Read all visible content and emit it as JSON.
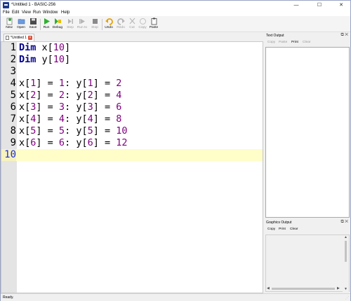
{
  "window": {
    "title": "*Untitled 1 - BASIC-256",
    "minimize_glyph": "—",
    "maximize_glyph": "☐",
    "close_glyph": "✕"
  },
  "menu": [
    "File",
    "Edit",
    "View",
    "Run",
    "Window",
    "Help"
  ],
  "toolbar": {
    "buttons": [
      {
        "label": "New",
        "icon": "new-file-icon",
        "enabled": true
      },
      {
        "label": "Open",
        "icon": "open-folder-icon",
        "enabled": true
      },
      {
        "label": "Save",
        "icon": "save-disk-icon",
        "enabled": true
      },
      {
        "label": "Run",
        "icon": "run-play-icon",
        "enabled": true
      },
      {
        "label": "Debug",
        "icon": "debug-icon",
        "enabled": true
      },
      {
        "label": "Step",
        "icon": "step-icon",
        "enabled": false
      },
      {
        "label": "Run to",
        "icon": "run-to-icon",
        "enabled": false
      },
      {
        "label": "Stop",
        "icon": "stop-icon",
        "enabled": false
      },
      {
        "label": "Undo",
        "icon": "undo-icon",
        "enabled": true
      },
      {
        "label": "Redo",
        "icon": "redo-icon",
        "enabled": false
      },
      {
        "label": "Cut",
        "icon": "cut-icon",
        "enabled": false
      },
      {
        "label": "Copy",
        "icon": "copy-icon",
        "enabled": false
      },
      {
        "label": "Paste",
        "icon": "paste-icon",
        "enabled": true
      }
    ]
  },
  "editor": {
    "tab_label": "*Untitled 1",
    "close_glyph": "×",
    "current_line": 10,
    "lines": [
      {
        "num": "1",
        "kw": "Dim",
        "rest": " x[",
        "n1": "10",
        "tail": "]"
      },
      {
        "num": "2",
        "kw": "Dim",
        "rest": " y[",
        "n1": "10",
        "tail": "]"
      },
      {
        "num": "3",
        "kw": "",
        "rest": "",
        "n1": "",
        "tail": ""
      },
      {
        "num": "4",
        "a": "x[",
        "i": "1",
        "b": "] = ",
        "v": "1",
        "c": ": y[",
        "j": "1",
        "d": "] = ",
        "w": "2"
      },
      {
        "num": "5",
        "a": "x[",
        "i": "2",
        "b": "] = ",
        "v": "2",
        "c": ": y[",
        "j": "2",
        "d": "] = ",
        "w": "4"
      },
      {
        "num": "6",
        "a": "x[",
        "i": "3",
        "b": "] = ",
        "v": "3",
        "c": ": y[",
        "j": "3",
        "d": "] = ",
        "w": "6"
      },
      {
        "num": "7",
        "a": "x[",
        "i": "4",
        "b": "] = ",
        "v": "4",
        "c": ": y[",
        "j": "4",
        "d": "] = ",
        "w": "8"
      },
      {
        "num": "8",
        "a": "x[",
        "i": "5",
        "b": "] = ",
        "v": "5",
        "c": ": y[",
        "j": "5",
        "d": "] = ",
        "w": "10"
      },
      {
        "num": "9",
        "a": "x[",
        "i": "6",
        "b": "] = ",
        "v": "6",
        "c": ": y[",
        "j": "6",
        "d": "] = ",
        "w": "12"
      },
      {
        "num": "10"
      }
    ],
    "colors": {
      "keyword": "#00008b",
      "number": "#800080",
      "current_line_bg": "#fffdc8",
      "current_line_number": "#1c2fd6"
    }
  },
  "text_output": {
    "title": "Text Output",
    "tools": [
      "Copy",
      "Paste",
      "Print",
      "Clear"
    ],
    "dock_glyphs": [
      "⧉",
      "✕"
    ]
  },
  "graphics_output": {
    "title": "Graphics Output",
    "tools": [
      "Copy",
      "Print",
      "Clear"
    ],
    "dock_glyphs": [
      "⧉",
      "✕"
    ]
  },
  "status": {
    "text": "Ready."
  }
}
